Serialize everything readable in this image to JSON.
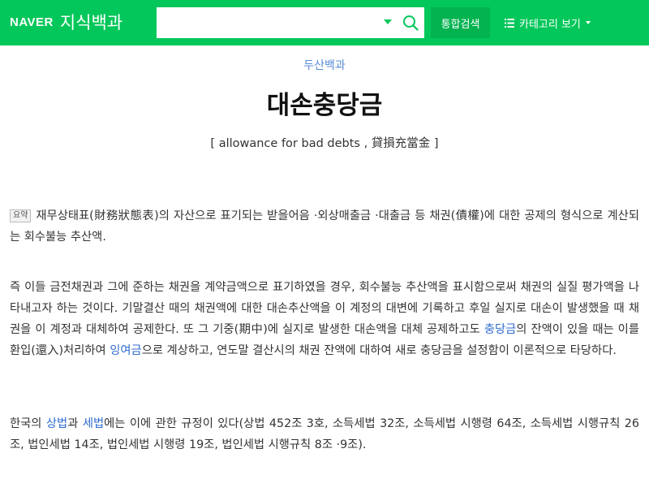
{
  "header": {
    "logo_brand": "NAVER",
    "logo_service": "지식백과",
    "search_value": "",
    "search_button": "통합검색",
    "category_button": "카테고리 보기",
    "accent_color": "#03c75a"
  },
  "article": {
    "source": "두산백과",
    "title": "대손충당금",
    "subtitle": "[ allowance for bad debts , 貸損充當金 ]",
    "summary_badge": "요약",
    "summary": "재무상태표(財務狀態表)의 자산으로 표기되는 받을어음 ·외상매출금 ·대출금 등 채권(債權)에 대한 공제의 형식으로 계산되는 회수불능 추산액.",
    "body1_a": "즉 이들 금전채권과 그에 준하는 채권을 계약금액으로 표기하였을 경우, 회수불능 추산액을 표시함으로써 채권의 실질 평가액을 나타내고자 하는 것이다. 기말결산 때의 채권액에 대한 대손추산액을 이 계정의 대변에 기록하고 후일 실지로 대손이 발생했을 때 채권을 이 계정과 대체하여 공제한다. 또 그 기중(期中)에 실지로 발생한 대손액을 대체 공제하고도 ",
    "link_reserve": "충당금",
    "body1_b": "의 잔액이 있을 때는 이를 환입(還入)처리하여 ",
    "link_surplus": "잉여금",
    "body1_c": "으로 계상하고, 연도말 결산시의 채권 잔액에 대하여 새로 충당금을 설정함이 이론적으로 타당하다.",
    "body2_a": "한국의 ",
    "link_commercial": "상법",
    "body2_b": "과 ",
    "link_tax": "세법",
    "body2_c": "에는 이에 관한 규정이 있다(상법 452조 3호, 소득세법 32조, 소득세법 시행령 64조, 소득세법 시행규칙 26조, 법인세법 14조, 법인세법 시행령 19조, 법인세법 시행규칙 8조 ·9조).",
    "link_color": "#2f6bcf"
  }
}
